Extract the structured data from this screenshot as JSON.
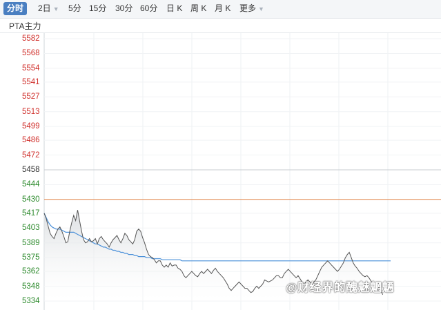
{
  "toolbar": {
    "tabs": [
      {
        "label": "分时",
        "active": true
      },
      {
        "label": "2日",
        "dropdown": true
      },
      {
        "label": "5分"
      },
      {
        "label": "15分"
      },
      {
        "label": "30分"
      },
      {
        "label": "60分"
      },
      {
        "label": "日 K"
      },
      {
        "label": "周 K"
      },
      {
        "label": "月 K"
      },
      {
        "label": "更多",
        "dropdown": true
      }
    ]
  },
  "chart_title": "PTA主力",
  "watermark": "@财经界的醜魅魍魉",
  "colors": {
    "up": "#d0312d",
    "down": "#2e8b2e",
    "neutral": "#333333",
    "price_line": "#555555",
    "avg_line": "#4a90d9",
    "limit_line": "#e07b3c",
    "active_tab": "#4a7fc1"
  },
  "chart_data": {
    "type": "line",
    "title": "PTA主力",
    "y_ticks": [
      {
        "label": "5582",
        "value": 5582,
        "color": "up"
      },
      {
        "label": "5568",
        "value": 5568,
        "color": "up"
      },
      {
        "label": "5554",
        "value": 5554,
        "color": "up"
      },
      {
        "label": "5541",
        "value": 5541,
        "color": "up"
      },
      {
        "label": "5527",
        "value": 5527,
        "color": "up"
      },
      {
        "label": "5513",
        "value": 5513,
        "color": "up"
      },
      {
        "label": "5499",
        "value": 5499,
        "color": "up"
      },
      {
        "label": "5486",
        "value": 5486,
        "color": "up"
      },
      {
        "label": "5472",
        "value": 5472,
        "color": "up"
      },
      {
        "label": "5458",
        "value": 5458,
        "color": "neutral"
      },
      {
        "label": "5444",
        "value": 5444,
        "color": "down"
      },
      {
        "label": "5430",
        "value": 5430,
        "color": "down"
      },
      {
        "label": "5417",
        "value": 5417,
        "color": "down"
      },
      {
        "label": "5403",
        "value": 5403,
        "color": "down"
      },
      {
        "label": "5389",
        "value": 5389,
        "color": "down"
      },
      {
        "label": "5375",
        "value": 5375,
        "color": "down"
      },
      {
        "label": "5362",
        "value": 5362,
        "color": "down"
      },
      {
        "label": "5348",
        "value": 5348,
        "color": "down"
      },
      {
        "label": "5334",
        "value": 5334,
        "color": "down"
      }
    ],
    "ylim": [
      5334,
      5582
    ],
    "reference_price": 5458,
    "orange_level": 5430,
    "grid": true,
    "series": [
      {
        "key": "price",
        "values": [
          5417,
          5412,
          5405,
          5398,
          5395,
          5393,
          5398,
          5402,
          5404,
          5400,
          5395,
          5389,
          5390,
          5400,
          5408,
          5415,
          5410,
          5420,
          5410,
          5400,
          5392,
          5389,
          5390,
          5393,
          5390,
          5391,
          5393,
          5388,
          5393,
          5395,
          5392,
          5390,
          5388,
          5385,
          5389,
          5392,
          5394,
          5396,
          5392,
          5389,
          5393,
          5398,
          5396,
          5392,
          5390,
          5388,
          5392,
          5400,
          5402,
          5400,
          5394,
          5389,
          5383,
          5378,
          5376,
          5375,
          5373,
          5370,
          5372,
          5372,
          5368,
          5366,
          5368,
          5366,
          5370,
          5367,
          5368,
          5368,
          5365,
          5364,
          5362,
          5358,
          5356,
          5358,
          5360,
          5362,
          5360,
          5358,
          5357,
          5360,
          5362,
          5360,
          5362,
          5364,
          5362,
          5360,
          5363,
          5365,
          5362,
          5360,
          5358,
          5356,
          5353,
          5350,
          5346,
          5344,
          5346,
          5348,
          5350,
          5352,
          5350,
          5348,
          5346,
          5346,
          5344,
          5342,
          5343,
          5346,
          5348,
          5346,
          5348,
          5350,
          5354,
          5353,
          5352,
          5353,
          5354,
          5356,
          5358,
          5358,
          5356,
          5356,
          5360,
          5362,
          5364,
          5362,
          5360,
          5358,
          5356,
          5358,
          5355,
          5352,
          5350,
          5352,
          5354,
          5352,
          5350,
          5352,
          5354,
          5358,
          5362,
          5366,
          5368,
          5370,
          5372,
          5370,
          5368,
          5366,
          5364,
          5362,
          5364,
          5367,
          5370,
          5375,
          5378,
          5380,
          5375,
          5370,
          5367,
          5365,
          5362,
          5360,
          5358,
          5357,
          5358,
          5356,
          5353,
          5350,
          5347,
          5348,
          5346,
          5344,
          5340
        ]
      },
      {
        "key": "avg",
        "values": [
          5417,
          5413,
          5409,
          5406,
          5404,
          5403,
          5402,
          5402,
          5402,
          5401,
          5400,
          5399,
          5399,
          5399,
          5399,
          5399,
          5398,
          5397,
          5396,
          5395,
          5394,
          5393,
          5392,
          5391,
          5390,
          5389,
          5388,
          5388,
          5387,
          5386,
          5385,
          5385,
          5384,
          5383,
          5383,
          5382,
          5382,
          5381,
          5381,
          5380,
          5380,
          5379,
          5379,
          5378,
          5378,
          5378,
          5377,
          5377,
          5376,
          5376,
          5376,
          5376,
          5375,
          5375,
          5375,
          5374,
          5374,
          5374,
          5374,
          5374,
          5373,
          5373,
          5373,
          5373,
          5373,
          5373,
          5373,
          5373,
          5373,
          5373,
          5372,
          5372,
          5372,
          5372,
          5372,
          5372,
          5372,
          5372,
          5372,
          5372,
          5372,
          5372,
          5372,
          5372,
          5372,
          5372,
          5372,
          5372,
          5372,
          5372,
          5372,
          5372,
          5372,
          5372,
          5372,
          5372,
          5372,
          5372,
          5372,
          5372,
          5372,
          5372,
          5372,
          5372,
          5372,
          5372,
          5372,
          5372,
          5372,
          5372,
          5372,
          5372,
          5372,
          5372,
          5372,
          5372,
          5372,
          5372,
          5372,
          5372,
          5372,
          5372,
          5372,
          5372,
          5372,
          5372,
          5372,
          5372,
          5372,
          5372,
          5372,
          5372,
          5372,
          5372,
          5372,
          5372,
          5372,
          5372,
          5372,
          5372,
          5372,
          5372,
          5372,
          5372,
          5372,
          5372,
          5372,
          5372,
          5372,
          5372,
          5372,
          5372,
          5372,
          5372,
          5372,
          5372,
          5372,
          5372,
          5372,
          5372,
          5372,
          5372,
          5372,
          5372,
          5372,
          5372,
          5372,
          5372,
          5372,
          5372,
          5372,
          5372,
          5372,
          5372,
          5372,
          5372,
          5372
        ]
      }
    ]
  }
}
